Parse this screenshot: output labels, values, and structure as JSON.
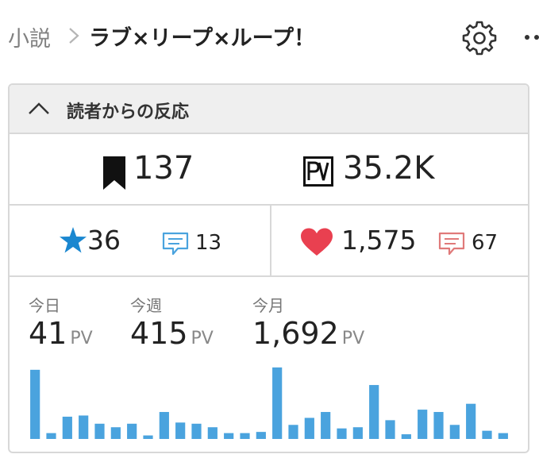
{
  "breadcrumb": {
    "root": "小説",
    "title": "ラブ×リープ×ループ！"
  },
  "icons": {
    "chevron": "chevron-right-icon",
    "settings": "gear-icon",
    "more": "more-icon"
  },
  "panel": {
    "title": "読者からの反応",
    "bookmarks": "137",
    "pv_total": "35.2K",
    "stars": "36",
    "star_comments": "13",
    "hearts": "1,575",
    "heart_comments": "67"
  },
  "colors": {
    "star": "#1a87d0",
    "heart": "#e94050",
    "bar": "#4aa3de",
    "comment_blue": "#4aa3de",
    "comment_red": "#e07a7a"
  },
  "stats": {
    "today_label": "今日",
    "today_value": "41",
    "week_label": "今週",
    "week_value": "415",
    "month_label": "今月",
    "month_value": "1,692",
    "unit": "PV"
  },
  "chart_data": {
    "type": "bar",
    "values": [
      59,
      5,
      19,
      20,
      13,
      10,
      13,
      3,
      23,
      14,
      13,
      10,
      5,
      5,
      6,
      61,
      12,
      18,
      23,
      9,
      10,
      46,
      16,
      4,
      25,
      23,
      12,
      30,
      7,
      5
    ],
    "ylim": [
      0,
      65
    ]
  }
}
